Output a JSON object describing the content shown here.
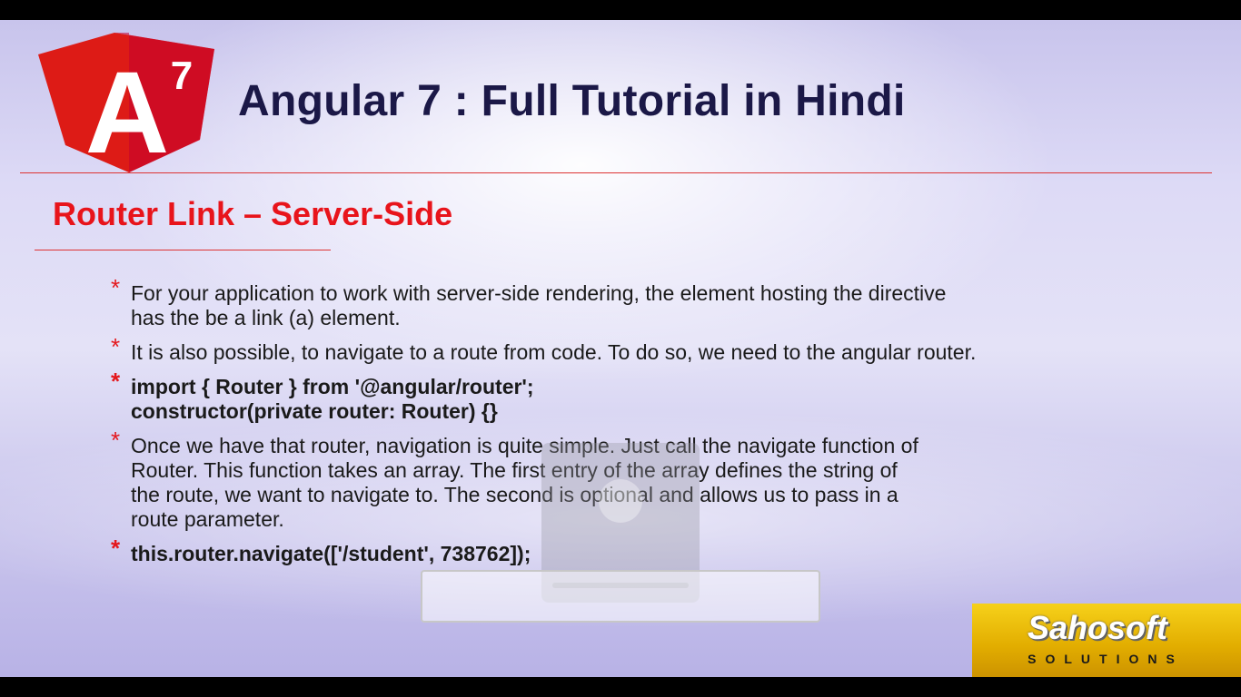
{
  "slide": {
    "logo": {
      "letter": "A",
      "superscript": "7"
    },
    "title": "Angular 7 : Full Tutorial in Hindi",
    "section_title": "Router Link – Server-Side",
    "bullet_marker": "*",
    "bullets": [
      {
        "lines": [
          "For your application to work with server-side  rendering, the element hosting the directive",
          "has the be a link (a) element."
        ],
        "style": "regular"
      },
      {
        "lines": [
          "It is also possible, to navigate to a route from code. To do so, we need to the angular router."
        ],
        "style": "regular"
      },
      {
        "lines": [
          "import { Router } from '@angular/router';",
          "constructor(private router: Router) {}"
        ],
        "style": "bold"
      },
      {
        "lines": [
          "Once we have that router, navigation is quite simple. Just call the navigate function of",
          "Router. This function takes an array. The first entry of the array defines the string of",
          "the route, we want to navigate to. The second is optional and allows us to pass in a",
          "route parameter."
        ],
        "style": "regular"
      },
      {
        "lines": [
          "this.router.navigate(['/student', 738762]);"
        ],
        "style": "bold"
      }
    ]
  },
  "branding": {
    "name": "Sahosoft",
    "tagline": "SOLUTIONS"
  },
  "colors": {
    "title": "#1b1847",
    "section_title": "#e8141b",
    "bullet_marker": "#e4171c",
    "angular_red": "#dd1b16",
    "brand_yellow": "#f2c200"
  },
  "icons": [
    "angular-logo-icon",
    "brightness-icon"
  ]
}
